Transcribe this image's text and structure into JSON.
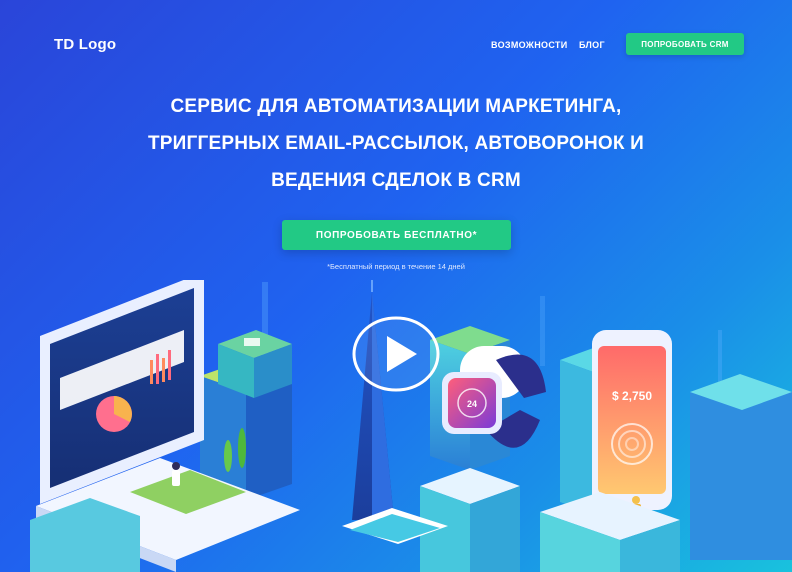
{
  "header": {
    "logo": "TD Logo",
    "nav": {
      "features": "ВОЗМОЖНОСТИ",
      "blog": "БЛОГ"
    },
    "cta": "ПОПРОБОВАТЬ CRM"
  },
  "hero": {
    "title_lines": [
      "СЕРВИС ДЛЯ АВТОМАТИЗАЦИИ МАРКЕТИНГА,",
      "ТРИГГЕРНЫХ EMAIL-РАССЫЛОК, АВТОВОРОНОК И",
      "ВЕДЕНИЯ СДЕЛОК В CRM"
    ],
    "cta": "ПОПРОБОВАТЬ БЕСПЛАТНО*",
    "note": "*Бесплатный период в течение 14 дней"
  },
  "illustration": {
    "watch_value": "24",
    "phone_amount": "$ 2,750"
  },
  "colors": {
    "accent_green": "#22c985",
    "bg_start": "#2a45d9",
    "bg_end": "#19c2dd"
  }
}
